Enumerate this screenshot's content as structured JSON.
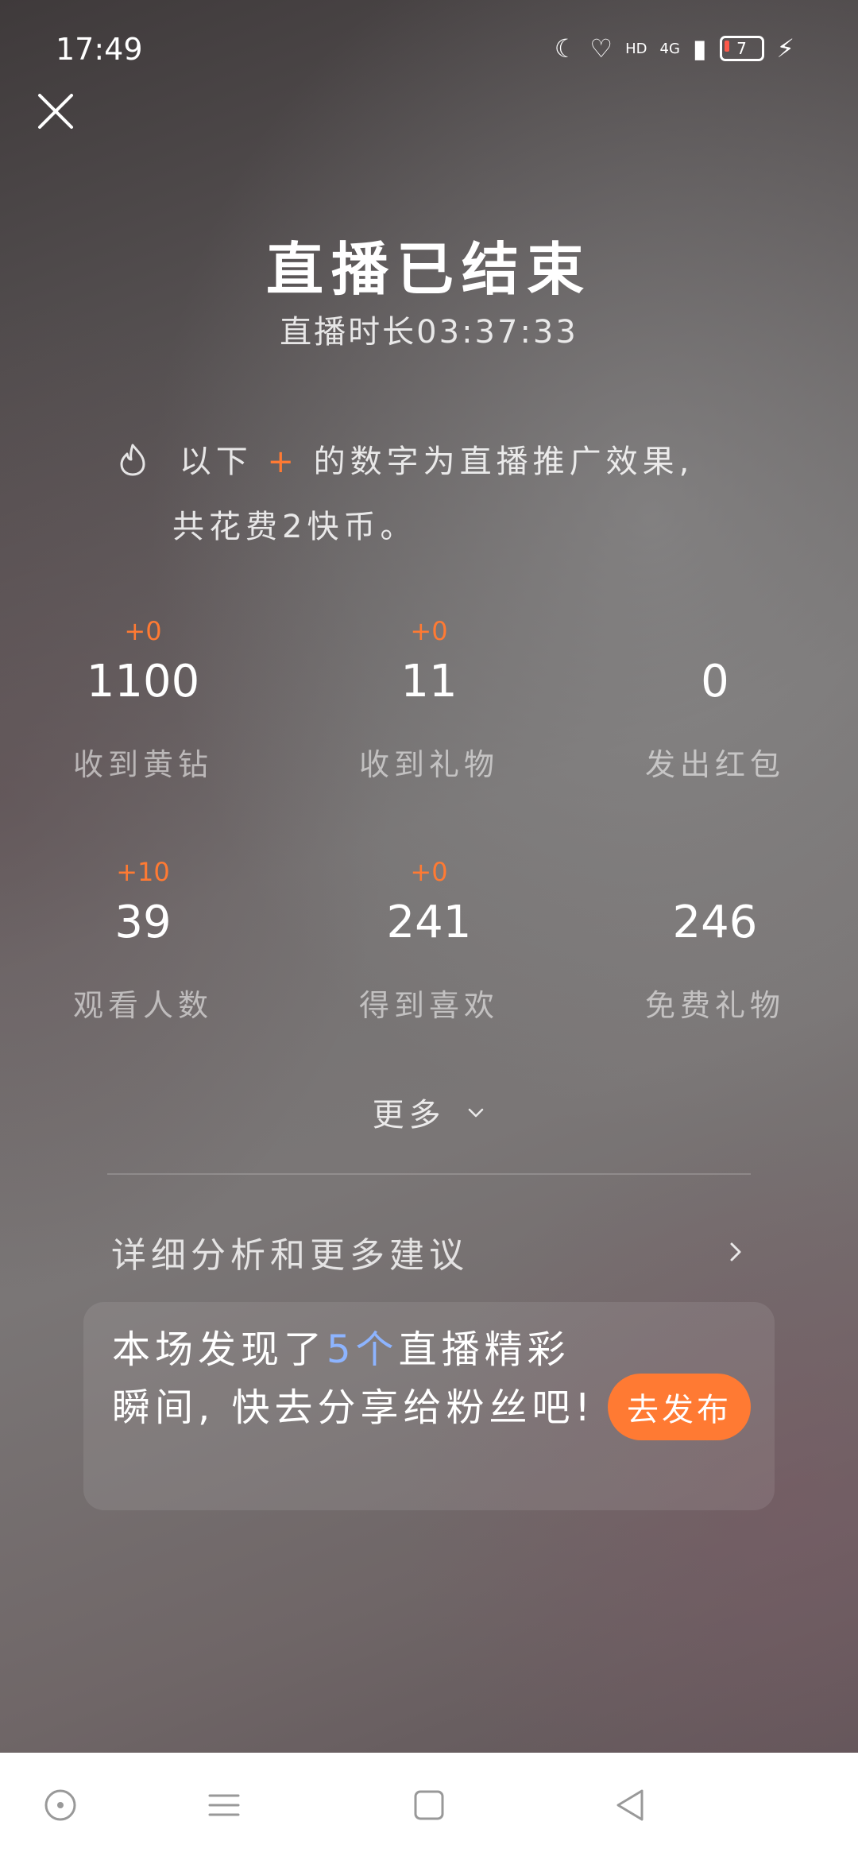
{
  "status_bar": {
    "time": "17:49",
    "network": "4G",
    "battery": "7"
  },
  "header": {
    "title": "直播已结束",
    "duration": "直播时长03:37:33"
  },
  "promo": {
    "line1_prefix": "以下",
    "plus": "+",
    "line1_suffix": "的数字为直播推广效果,",
    "line2": "共花费2快币。"
  },
  "stats": [
    {
      "delta": "+0",
      "value": "1100",
      "label": "收到黄钻"
    },
    {
      "delta": "+0",
      "value": "11",
      "label": "收到礼物"
    },
    {
      "delta": "",
      "value": "0",
      "label": "发出红包"
    },
    {
      "delta": "+10",
      "value": "39",
      "label": "观看人数"
    },
    {
      "delta": "+0",
      "value": "241",
      "label": "得到喜欢"
    },
    {
      "delta": "",
      "value": "246",
      "label": "免费礼物"
    }
  ],
  "more_label": "更多",
  "analysis_label": "详细分析和更多建议",
  "card": {
    "text_prefix": "本场发现了",
    "highlight": "5个",
    "text_suffix": "直播精彩瞬间, 快去分享给粉丝吧!",
    "button": "去发布"
  },
  "colors": {
    "accent": "#ff7a33",
    "highlight": "#8db4ff"
  }
}
